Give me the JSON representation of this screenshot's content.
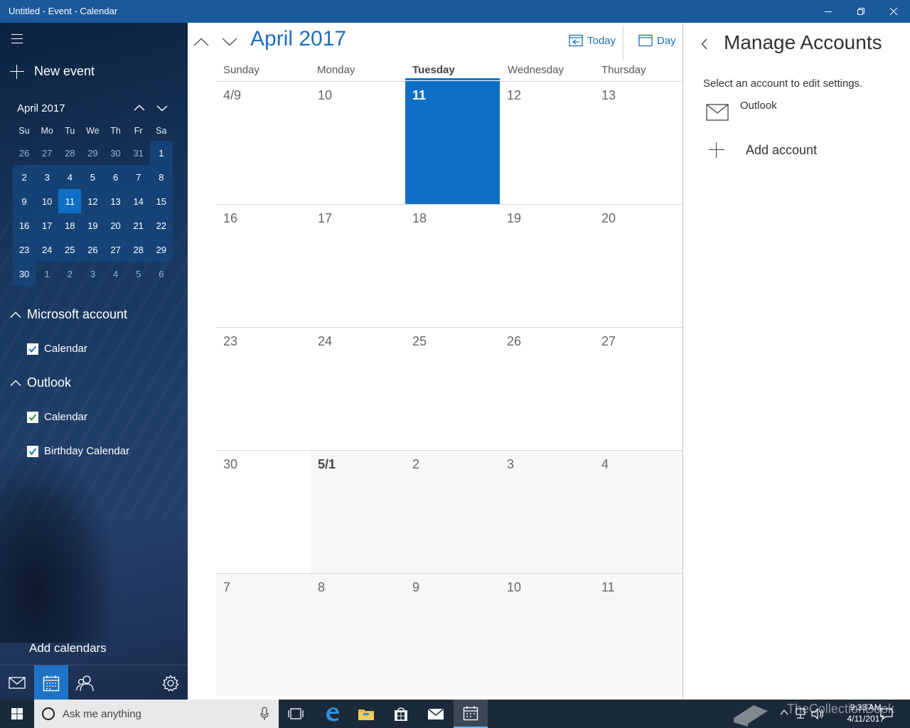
{
  "window": {
    "title": "Untitled - Event - Calendar"
  },
  "sidebar": {
    "new_event": "New event",
    "mini_calendar": {
      "title": "April 2017",
      "weekdays": [
        "Su",
        "Mo",
        "Tu",
        "We",
        "Th",
        "Fr",
        "Sa"
      ],
      "weeks": [
        [
          "26",
          "27",
          "28",
          "29",
          "30",
          "31",
          "1"
        ],
        [
          "2",
          "3",
          "4",
          "5",
          "6",
          "7",
          "8"
        ],
        [
          "9",
          "10",
          "11",
          "12",
          "13",
          "14",
          "15"
        ],
        [
          "16",
          "17",
          "18",
          "19",
          "20",
          "21",
          "22"
        ],
        [
          "23",
          "24",
          "25",
          "26",
          "27",
          "28",
          "29"
        ],
        [
          "30",
          "1",
          "2",
          "3",
          "4",
          "5",
          "6"
        ]
      ],
      "today": "11"
    },
    "groups": [
      {
        "name": "Microsoft account",
        "calendars": [
          {
            "label": "Calendar",
            "checked": true,
            "color": "#1d74c6"
          }
        ]
      },
      {
        "name": "Outlook",
        "calendars": [
          {
            "label": "Calendar",
            "checked": true,
            "color": "#2e9e3e"
          },
          {
            "label": "Birthday Calendar",
            "checked": true,
            "color": "#1d74c6"
          }
        ]
      }
    ],
    "add_calendars": "Add calendars"
  },
  "main": {
    "month_title": "April 2017",
    "today_button": "Today",
    "view_button": "Day",
    "day_headers": [
      "Sunday",
      "Monday",
      "Tuesday",
      "Wednesday",
      "Thursday"
    ],
    "today_column": "Tuesday",
    "weeks": [
      [
        "4/9",
        "10",
        "11",
        "12",
        "13"
      ],
      [
        "16",
        "17",
        "18",
        "19",
        "20"
      ],
      [
        "23",
        "24",
        "25",
        "26",
        "27"
      ],
      [
        "30",
        "5/1",
        "2",
        "3",
        "4"
      ],
      [
        "7",
        "8",
        "9",
        "10",
        "11"
      ]
    ],
    "accent_color": "#0f6fc6"
  },
  "manage_accounts": {
    "title": "Manage Accounts",
    "subtitle": "Select an account to edit settings.",
    "accounts": [
      {
        "name": "Outlook",
        "icon": "mail-icon"
      }
    ],
    "add_account": "Add account"
  },
  "taskbar": {
    "search_placeholder": "Ask me anything",
    "time": "9:33 AM",
    "date": "4/11/2017",
    "watermark": "TheCollectionBook"
  }
}
